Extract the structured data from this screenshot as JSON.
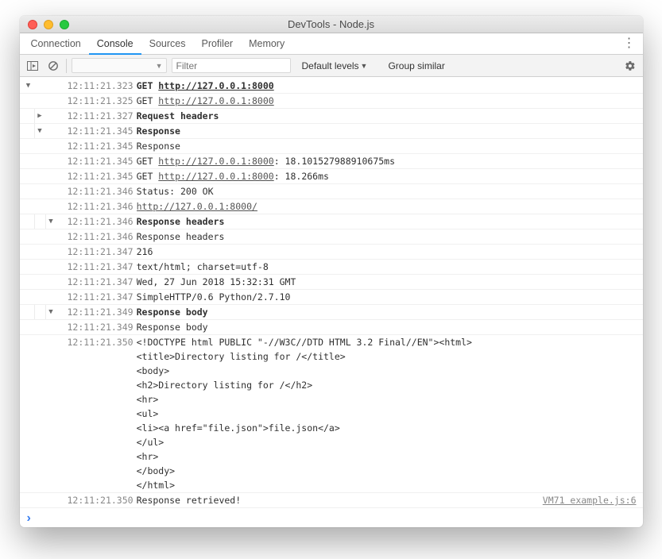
{
  "window": {
    "title": "DevTools - Node.js"
  },
  "tabs": [
    "Connection",
    "Console",
    "Sources",
    "Profiler",
    "Memory"
  ],
  "active_tab_index": 1,
  "toolbar": {
    "filter_placeholder": "Filter",
    "levels_label": "Default levels",
    "group_similar_label": "Group similar"
  },
  "console": {
    "rows": [
      {
        "depth": 0,
        "arrow": "down",
        "ts": "12:11:21.323",
        "parts": [
          {
            "t": "GET ",
            "b": true
          },
          {
            "t": "http://127.0.0.1:8000",
            "link": true,
            "b": true
          }
        ]
      },
      {
        "depth": 1,
        "arrow": "",
        "ts": "12:11:21.325",
        "parts": [
          {
            "t": "GET "
          },
          {
            "t": "http://127.0.0.1:8000",
            "link": true
          }
        ]
      },
      {
        "depth": 1,
        "arrow": "right",
        "ts": "12:11:21.327",
        "parts": [
          {
            "t": "Request headers",
            "b": true
          }
        ]
      },
      {
        "depth": 1,
        "arrow": "down",
        "ts": "12:11:21.345",
        "parts": [
          {
            "t": "Response",
            "b": true
          }
        ]
      },
      {
        "depth": 2,
        "arrow": "",
        "ts": "12:11:21.345",
        "parts": [
          {
            "t": "Response"
          }
        ]
      },
      {
        "depth": 2,
        "arrow": "",
        "ts": "12:11:21.345",
        "parts": [
          {
            "t": "GET "
          },
          {
            "t": "http://127.0.0.1:8000",
            "link": true
          },
          {
            "t": ": 18.101527988910675ms"
          }
        ]
      },
      {
        "depth": 2,
        "arrow": "",
        "ts": "12:11:21.345",
        "parts": [
          {
            "t": "GET "
          },
          {
            "t": "http://127.0.0.1:8000",
            "link": true
          },
          {
            "t": ": 18.266ms"
          }
        ]
      },
      {
        "depth": 2,
        "arrow": "",
        "ts": "12:11:21.346",
        "parts": [
          {
            "t": "Status: 200 OK"
          }
        ]
      },
      {
        "depth": 2,
        "arrow": "",
        "ts": "12:11:21.346",
        "parts": [
          {
            "t": "http://127.0.0.1:8000/",
            "link": true
          }
        ]
      },
      {
        "depth": 2,
        "arrow": "down",
        "ts": "12:11:21.346",
        "parts": [
          {
            "t": "Response headers",
            "b": true
          }
        ]
      },
      {
        "depth": 3,
        "arrow": "",
        "ts": "12:11:21.346",
        "parts": [
          {
            "t": "Response headers"
          }
        ]
      },
      {
        "depth": 3,
        "arrow": "",
        "ts": "12:11:21.347",
        "parts": [
          {
            "t": "216"
          }
        ]
      },
      {
        "depth": 3,
        "arrow": "",
        "ts": "12:11:21.347",
        "parts": [
          {
            "t": "text/html; charset=utf-8"
          }
        ]
      },
      {
        "depth": 3,
        "arrow": "",
        "ts": "12:11:21.347",
        "parts": [
          {
            "t": "Wed, 27 Jun 2018 15:32:31 GMT"
          }
        ]
      },
      {
        "depth": 3,
        "arrow": "",
        "ts": "12:11:21.347",
        "parts": [
          {
            "t": "SimpleHTTP/0.6 Python/2.7.10"
          }
        ]
      },
      {
        "depth": 2,
        "arrow": "down",
        "ts": "12:11:21.349",
        "parts": [
          {
            "t": "Response body",
            "b": true
          }
        ]
      },
      {
        "depth": 3,
        "arrow": "",
        "ts": "12:11:21.349",
        "parts": [
          {
            "t": "Response body"
          }
        ]
      },
      {
        "depth": 3,
        "arrow": "",
        "ts": "12:11:21.350",
        "parts": [
          {
            "t": "<!DOCTYPE html PUBLIC \"-//W3C//DTD HTML 3.2 Final//EN\"><html>\n<title>Directory listing for /</title>\n<body>\n<h2>Directory listing for /</h2>\n<hr>\n<ul>\n<li><a href=\"file.json\">file.json</a>\n</ul>\n<hr>\n</body>\n</html>"
          }
        ]
      },
      {
        "depth": 0,
        "arrow": "",
        "ts": "12:11:21.350",
        "parts": [
          {
            "t": "Response retrieved!"
          }
        ],
        "right": "VM71 example.js:6"
      }
    ]
  }
}
